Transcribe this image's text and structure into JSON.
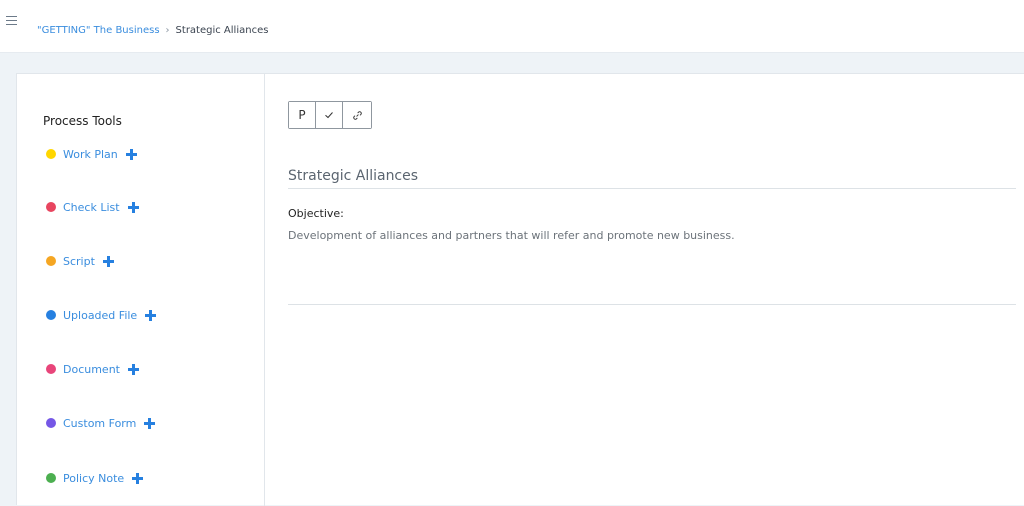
{
  "header": {
    "menu_icon": "hamburger-icon",
    "breadcrumb": {
      "parent": "\"GETTING\" The Business",
      "separator": ">",
      "current": "Strategic Alliances"
    }
  },
  "sidebar": {
    "title": "Process Tools",
    "items": [
      {
        "label": "Work Plan",
        "color": "#ffd600"
      },
      {
        "label": "Check List",
        "color": "#e8455f"
      },
      {
        "label": "Script",
        "color": "#f5a623"
      },
      {
        "label": "Uploaded File",
        "color": "#2680e0"
      },
      {
        "label": "Document",
        "color": "#e8457a"
      },
      {
        "label": "Custom Form",
        "color": "#7557e6"
      },
      {
        "label": "Policy Note",
        "color": "#4caf50"
      }
    ]
  },
  "toolbar": {
    "p_label": "P",
    "check_icon": "check-icon",
    "link_icon": "link-icon"
  },
  "main": {
    "title": "Strategic Alliances",
    "objective_label": "Objective:",
    "objective_text": "Development of alliances and partners that will refer and promote new business."
  }
}
